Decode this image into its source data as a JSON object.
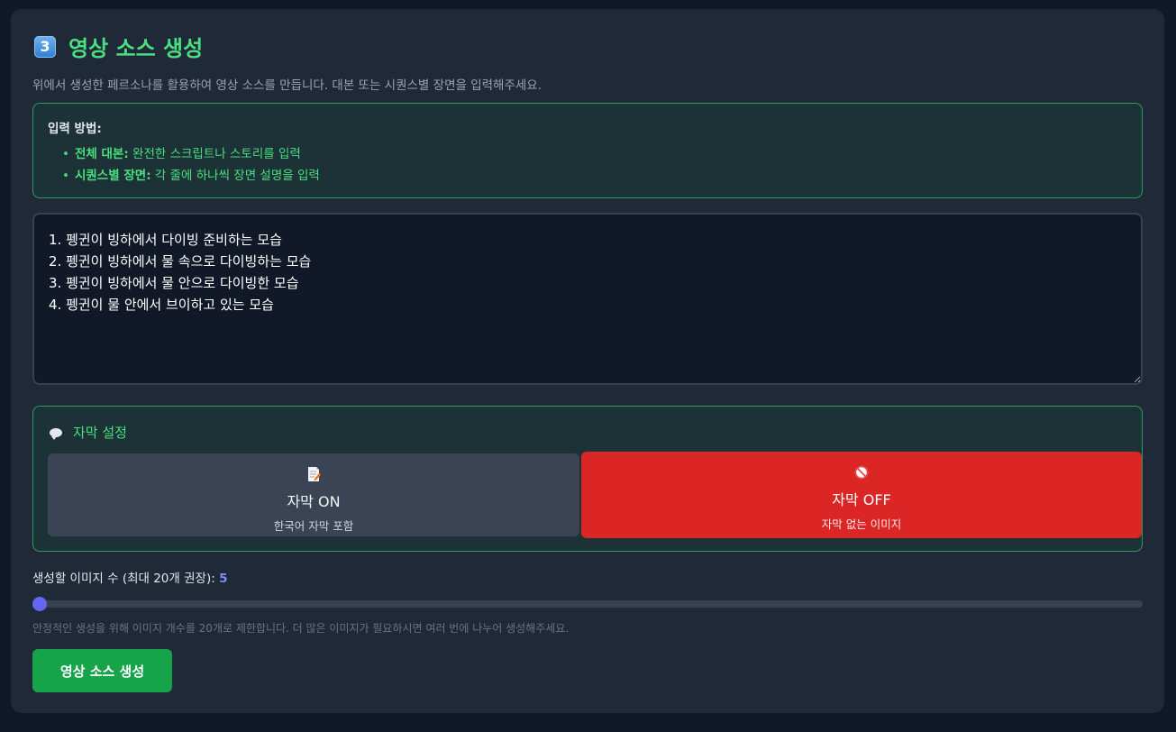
{
  "section": {
    "number_badge": "3",
    "title": "영상 소스 생성",
    "description": "위에서 생성한 페르소나를 활용하여 영상 소스를 만듭니다. 대본 또는 시퀀스별 장면을 입력해주세요."
  },
  "input_method": {
    "heading": "입력 방법:",
    "items": [
      {
        "term": "전체 대본:",
        "text": " 완전한 스크립트나 스토리를 입력"
      },
      {
        "term": "시퀀스별 장면:",
        "text": " 각 줄에 하나씩 장면 설명을 입력"
      }
    ]
  },
  "script_input": {
    "value": "1. 펭귄이 빙하에서 다이빙 준비하는 모습\n2. 펭귄이 빙하에서 물 속으로 다이빙하는 모습\n3. 펭귄이 빙하에서 물 안으로 다이빙한 모습\n4. 펭귄이 물 안에서 브이하고 있는 모습"
  },
  "subtitle_settings": {
    "heading": "자막 설정",
    "on": {
      "label": "자막 ON",
      "sub": "한국어 자막 포함",
      "icon": "memo-icon"
    },
    "off": {
      "label": "자막 OFF",
      "sub": "자막 없는 이미지",
      "icon": "no-entry-icon"
    },
    "selected": "off"
  },
  "image_count": {
    "label": "생성할 이미지 수 (최대 20개 권장): ",
    "value": "5",
    "min": 5,
    "max": 20,
    "hint": "안정적인 생성을 위해 이미지 개수를 20개로 제한합니다. 더 많은 이미지가 필요하시면 여러 번에 나누어 생성해주세요."
  },
  "generate_button": {
    "label": "영상 소스 생성"
  },
  "colors": {
    "accent_green": "#4ade80",
    "selected_red": "#dc2626",
    "slider_thumb": "#6366f1",
    "button_green": "#16a34a"
  }
}
